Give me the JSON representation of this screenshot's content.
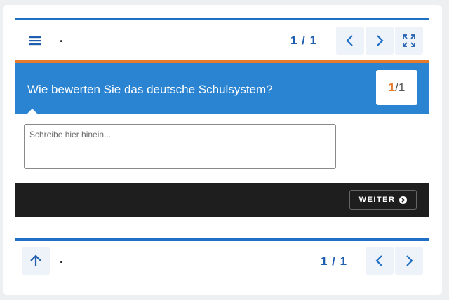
{
  "top_nav": {
    "menu_icon": "hamburger-menu-icon",
    "title_dot": ".",
    "counter": "1 / 1",
    "prev_icon": "chevron-left-icon",
    "next_icon": "chevron-right-icon",
    "fullscreen_icon": "expand-icon"
  },
  "question": {
    "text": "Wie bewerten Sie das deutsche Schulsystem?",
    "badge_current": "1",
    "badge_sep": "/",
    "badge_total": "1"
  },
  "answer": {
    "placeholder": "Schreibe hier hinein..."
  },
  "footer": {
    "weiter_label": "WEITER",
    "weiter_icon": "arrow-circle-right-icon"
  },
  "bottom_nav": {
    "up_icon": "arrow-up-icon",
    "title_dot": ".",
    "counter": "1 / 1",
    "prev_icon": "chevron-left-icon",
    "next_icon": "chevron-right-icon"
  },
  "colors": {
    "accent_blue": "#1f6fc5",
    "question_bg": "#2a84d2",
    "accent_orange": "#e87a2c",
    "footer_bg": "#1e1e1e"
  }
}
